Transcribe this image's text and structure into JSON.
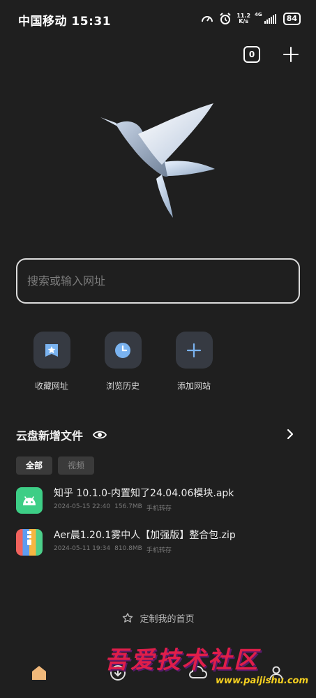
{
  "status_bar": {
    "carrier_time": "中国移动 15:31",
    "net_speed_value": "11.2",
    "net_speed_unit": "K/s",
    "network_type": "4G",
    "battery": "84"
  },
  "top_actions": {
    "tab_count": "0"
  },
  "search": {
    "placeholder": "搜索或输入网址"
  },
  "shortcuts": [
    {
      "label": "收藏网址",
      "icon": "bookmark-star-icon"
    },
    {
      "label": "浏览历史",
      "icon": "clock-icon"
    },
    {
      "label": "添加网站",
      "icon": "plus-icon"
    }
  ],
  "cloud": {
    "title": "云盘新增文件",
    "tabs": [
      {
        "label": "全部",
        "active": true
      },
      {
        "label": "视频",
        "active": false
      }
    ],
    "files": [
      {
        "name": "知乎 10.1.0-内置知了24.04.06模块.apk",
        "date": "2024-05-15 22:40",
        "size": "156.7MB",
        "source": "手机转存",
        "icon": "android-apk-icon",
        "color": "#3dce86"
      },
      {
        "name": "Aer晨1.20.1雾中人【加强版】整合包.zip",
        "date": "2024-05-11 19:34",
        "size": "810.8MB",
        "source": "手机转存",
        "icon": "zip-archive-icon",
        "color": "#f0625d"
      }
    ]
  },
  "customize_label": "定制我的首页",
  "watermark": {
    "text": "吾爱技术社区",
    "url": "www.paijishu.com"
  },
  "colors": {
    "background": "#1f1f1f",
    "tile": "#363a42",
    "accent_blue": "#7ab3f0"
  }
}
